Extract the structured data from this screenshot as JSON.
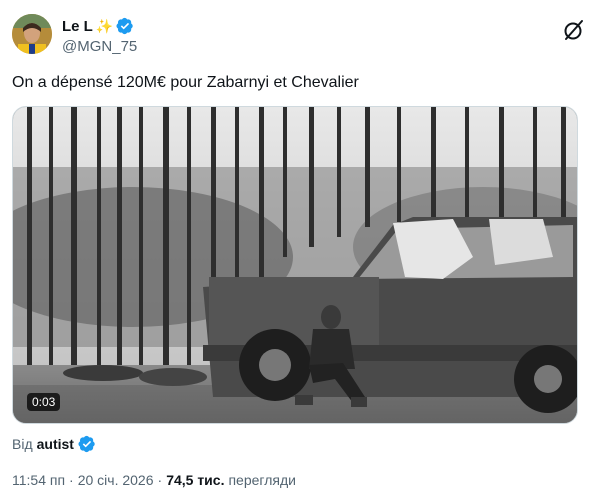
{
  "author": {
    "display_name": "Le L",
    "sparkle_icon": "✨",
    "handle": "@MGN_75",
    "verified_color": "#1d9bf0"
  },
  "tweet": {
    "text": "On a dépensé 120M€ pour Zabarnyi et Chevalier"
  },
  "media": {
    "duration": "0:03"
  },
  "source": {
    "prefix": "Від",
    "name": "autist"
  },
  "meta": {
    "time": "11:54 пп",
    "separator": "·",
    "date": "20 січ. 2026",
    "views_count": "74,5 тис.",
    "views_label": "перегляди"
  },
  "colors": {
    "accent": "#1d9bf0",
    "text": "#0f1419",
    "secondary": "#536471"
  }
}
